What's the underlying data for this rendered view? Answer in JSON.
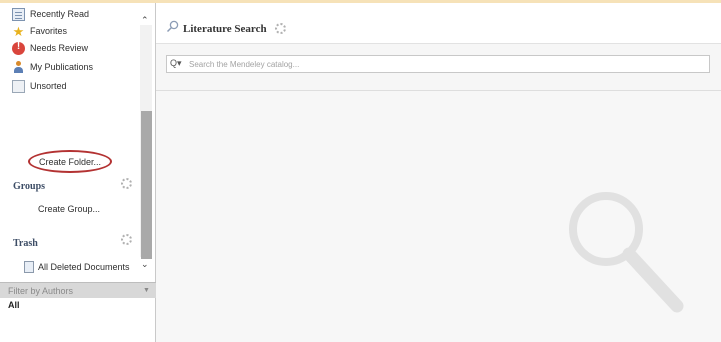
{
  "sidebar": {
    "library_items": [
      {
        "label": "Recently Read",
        "icon": "recently-read-icon"
      },
      {
        "label": "Favorites",
        "icon": "star-icon"
      },
      {
        "label": "Needs Review",
        "icon": "needs-review-icon"
      },
      {
        "label": "My Publications",
        "icon": "person-icon"
      },
      {
        "label": "Unsorted",
        "icon": "unsorted-icon"
      }
    ],
    "create_folder_label": "Create Folder...",
    "groups_title": "Groups",
    "create_group_label": "Create Group...",
    "trash_title": "Trash",
    "all_deleted_label": "All Deleted Documents",
    "filter_label": "Filter by Authors",
    "filter_value": "All"
  },
  "main": {
    "title": "Literature Search",
    "search_placeholder": "Search the Mendeley catalog..."
  },
  "colors": {
    "highlight_circle": "#b33232",
    "section_title": "#3d4d66"
  }
}
